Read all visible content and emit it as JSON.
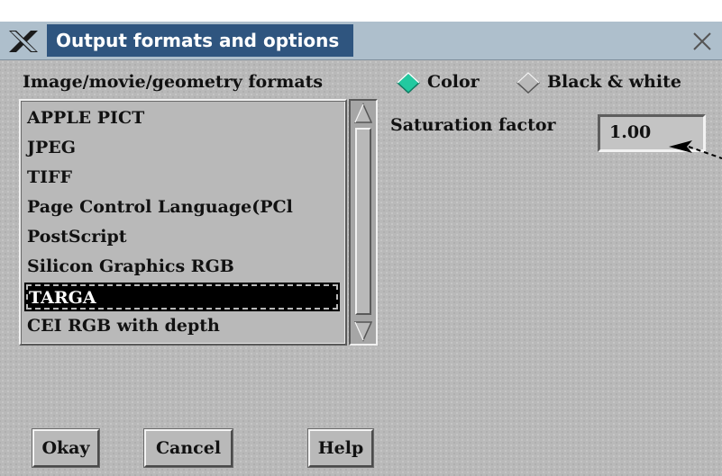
{
  "window": {
    "title": "Output formats and options",
    "icons": {
      "logo": "x-logo-icon",
      "close": "close-icon"
    }
  },
  "formats": {
    "label": "Image/movie/geometry formats",
    "items": [
      "APPLE PICT",
      "JPEG",
      "TIFF",
      "Page Control Language(PCl",
      "PostScript",
      "Silicon Graphics RGB",
      "TARGA",
      "CEI RGB with depth"
    ],
    "selected": "TARGA"
  },
  "color_mode": {
    "options": [
      {
        "label": "Color",
        "selected": true
      },
      {
        "label": "Black & white",
        "selected": false
      }
    ]
  },
  "saturation": {
    "label": "Saturation factor",
    "value": "1.00"
  },
  "buttons": {
    "okay": "Okay",
    "cancel": "Cancel",
    "help": "Help"
  },
  "colors": {
    "title_bg": "#2f557f",
    "titlebar": "#aebfcc",
    "panel": "#b9b9b9",
    "radio_selected": "#22c9a0"
  }
}
